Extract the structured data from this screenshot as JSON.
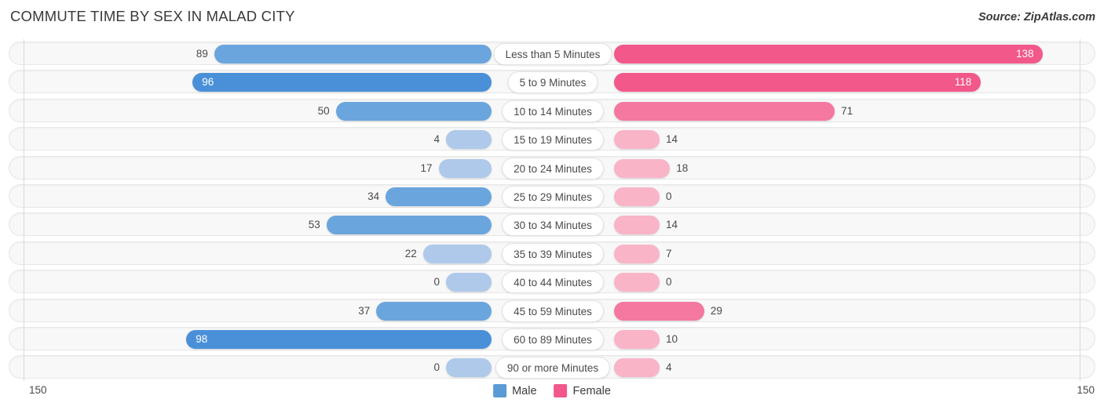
{
  "header": {
    "title": "COMMUTE TIME BY SEX IN MALAD CITY",
    "source": "Source: ZipAtlas.com"
  },
  "legend": {
    "items": [
      {
        "label": "Male",
        "color": "#5b9bd5"
      },
      {
        "label": "Female",
        "color": "#f2588a"
      }
    ]
  },
  "axis": {
    "left_max": "150",
    "right_max": "150",
    "max_value": 150
  },
  "colors": {
    "male_strong": "#4a90d9",
    "male_mid": "#6aa5dd",
    "male_light": "#aec9ea",
    "female_strong": "#f2588a",
    "female_mid": "#f4789f",
    "female_light": "#f9b4c8",
    "track": "#f8f8f8",
    "track_border": "#e7e7e7",
    "axis": "#d8d8d8"
  },
  "chart_data": {
    "type": "bar",
    "title": "COMMUTE TIME BY SEX IN MALAD CITY",
    "subtitle": "",
    "xlabel": "",
    "ylabel": "",
    "orientation": "horizontal-diverging",
    "xlim": [
      -150,
      150
    ],
    "grid": false,
    "legend_position": "bottom-center",
    "categories": [
      "Less than 5 Minutes",
      "5 to 9 Minutes",
      "10 to 14 Minutes",
      "15 to 19 Minutes",
      "20 to 24 Minutes",
      "25 to 29 Minutes",
      "30 to 34 Minutes",
      "35 to 39 Minutes",
      "40 to 44 Minutes",
      "45 to 59 Minutes",
      "60 to 89 Minutes",
      "90 or more Minutes"
    ],
    "series": [
      {
        "name": "Male",
        "values": [
          89,
          96,
          50,
          4,
          17,
          34,
          53,
          22,
          0,
          37,
          98,
          0
        ]
      },
      {
        "name": "Female",
        "values": [
          138,
          118,
          71,
          14,
          18,
          0,
          14,
          7,
          0,
          29,
          10,
          4
        ]
      }
    ],
    "rows": [
      {
        "category": "Less than 5 Minutes",
        "male": 89,
        "female": 138,
        "male_label": "89",
        "female_label": "138",
        "male_label_inside": false,
        "female_label_inside": true
      },
      {
        "category": "5 to 9 Minutes",
        "male": 96,
        "female": 118,
        "male_label": "96",
        "female_label": "118",
        "male_label_inside": true,
        "female_label_inside": true
      },
      {
        "category": "10 to 14 Minutes",
        "male": 50,
        "female": 71,
        "male_label": "50",
        "female_label": "71",
        "male_label_inside": false,
        "female_label_inside": false
      },
      {
        "category": "15 to 19 Minutes",
        "male": 4,
        "female": 14,
        "male_label": "4",
        "female_label": "14",
        "male_label_inside": false,
        "female_label_inside": false
      },
      {
        "category": "20 to 24 Minutes",
        "male": 17,
        "female": 18,
        "male_label": "17",
        "female_label": "18",
        "male_label_inside": false,
        "female_label_inside": false
      },
      {
        "category": "25 to 29 Minutes",
        "male": 34,
        "female": 0,
        "male_label": "34",
        "female_label": "0",
        "male_label_inside": false,
        "female_label_inside": false
      },
      {
        "category": "30 to 34 Minutes",
        "male": 53,
        "female": 14,
        "male_label": "53",
        "female_label": "14",
        "male_label_inside": false,
        "female_label_inside": false
      },
      {
        "category": "35 to 39 Minutes",
        "male": 22,
        "female": 7,
        "male_label": "22",
        "female_label": "7",
        "male_label_inside": false,
        "female_label_inside": false
      },
      {
        "category": "40 to 44 Minutes",
        "male": 0,
        "female": 0,
        "male_label": "0",
        "female_label": "0",
        "male_label_inside": false,
        "female_label_inside": false
      },
      {
        "category": "45 to 59 Minutes",
        "male": 37,
        "female": 29,
        "male_label": "37",
        "female_label": "29",
        "male_label_inside": false,
        "female_label_inside": false
      },
      {
        "category": "60 to 89 Minutes",
        "male": 98,
        "female": 10,
        "male_label": "98",
        "female_label": "10",
        "male_label_inside": true,
        "female_label_inside": false
      },
      {
        "category": "90 or more Minutes",
        "male": 0,
        "female": 4,
        "male_label": "0",
        "female_label": "4",
        "male_label_inside": false,
        "female_label_inside": false
      }
    ]
  }
}
